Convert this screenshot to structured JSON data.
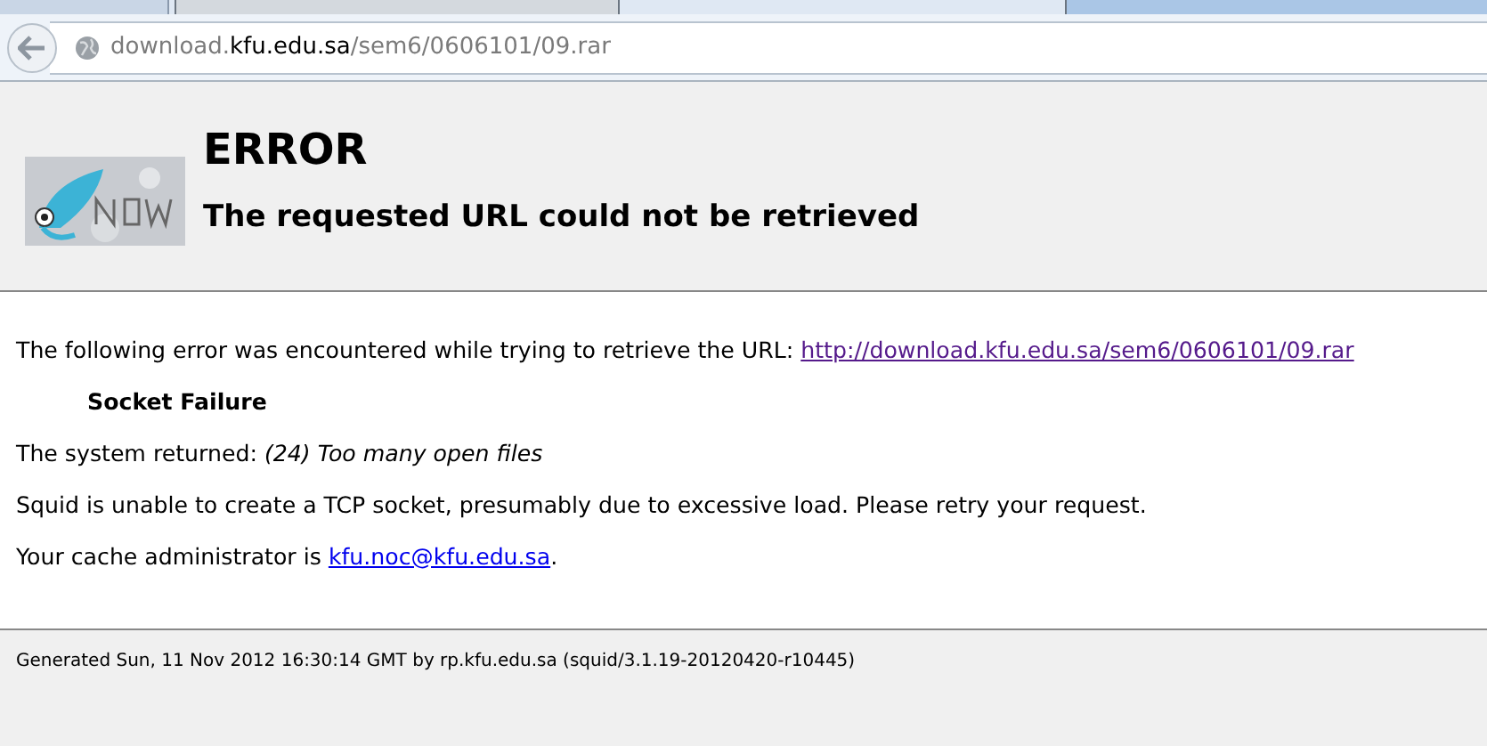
{
  "address_bar": {
    "parts": [
      {
        "text": "download.",
        "strong": false
      },
      {
        "text": "kfu.edu.sa",
        "strong": true
      },
      {
        "text": "/sem6/0606101/09.rar",
        "strong": false
      }
    ]
  },
  "header": {
    "title": "ERROR",
    "subtitle": "The requested URL could not be retrieved"
  },
  "body": {
    "intro": "The following error was encountered while trying to retrieve the URL: ",
    "url": "http://download.kfu.edu.sa/sem6/0606101/09.rar",
    "error_name": "Socket Failure",
    "returned_label": "The system returned: ",
    "returned_value": "(24) Too many open files",
    "explanation": "Squid is unable to create a TCP socket, presumably due to excessive load. Please retry your request.",
    "admin_label": "Your cache administrator is ",
    "admin_email": "kfu.noc@kfu.edu.sa",
    "admin_end": "."
  },
  "footer": "Generated Sun, 11 Nov 2012 16:30:14 GMT by rp.kfu.edu.sa (squid/3.1.19-20120420-r10445)"
}
